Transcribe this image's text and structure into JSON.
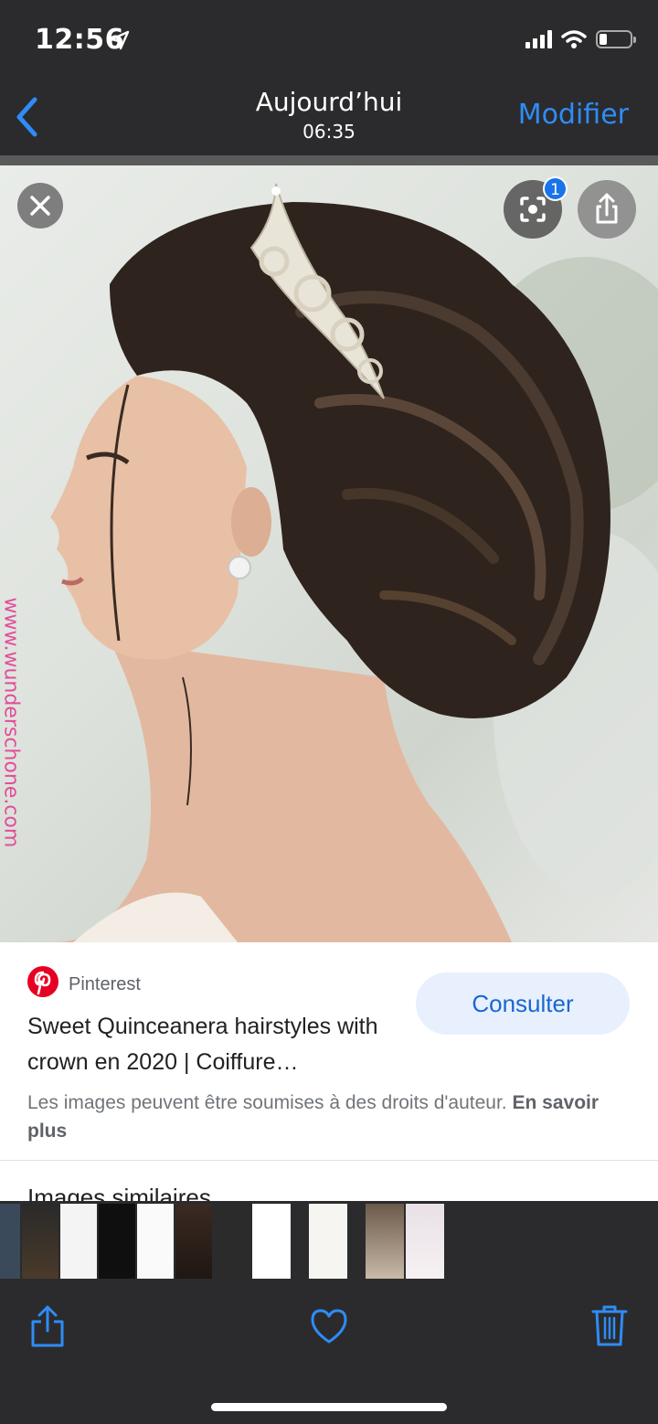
{
  "status_bar": {
    "time": "12:56"
  },
  "nav": {
    "title": "Aujourd’hui",
    "subtitle": "06:35",
    "edit_label": "Modifier"
  },
  "photo": {
    "watermark": "www.wunderschone.com",
    "lens_badge_count": "1"
  },
  "result": {
    "source": "Pinterest",
    "title": "Sweet Quinceanera hairstyles with crown en 2020 | Coiffure…",
    "visit_label": "Consulter",
    "copyright_text": "Les images peuvent être soumises à des droits d'auteur.",
    "learn_more": "En savoir plus",
    "similar_heading": "Images similaires"
  },
  "colors": {
    "accent": "#2f8cf6",
    "chrome": "#2b2b2d",
    "pinterest": "#e60023",
    "visit_bg": "#e8f0fe",
    "visit_text": "#1967d2"
  },
  "toolbar": {
    "items": [
      "share-icon",
      "heart-icon",
      "trash-icon"
    ]
  }
}
